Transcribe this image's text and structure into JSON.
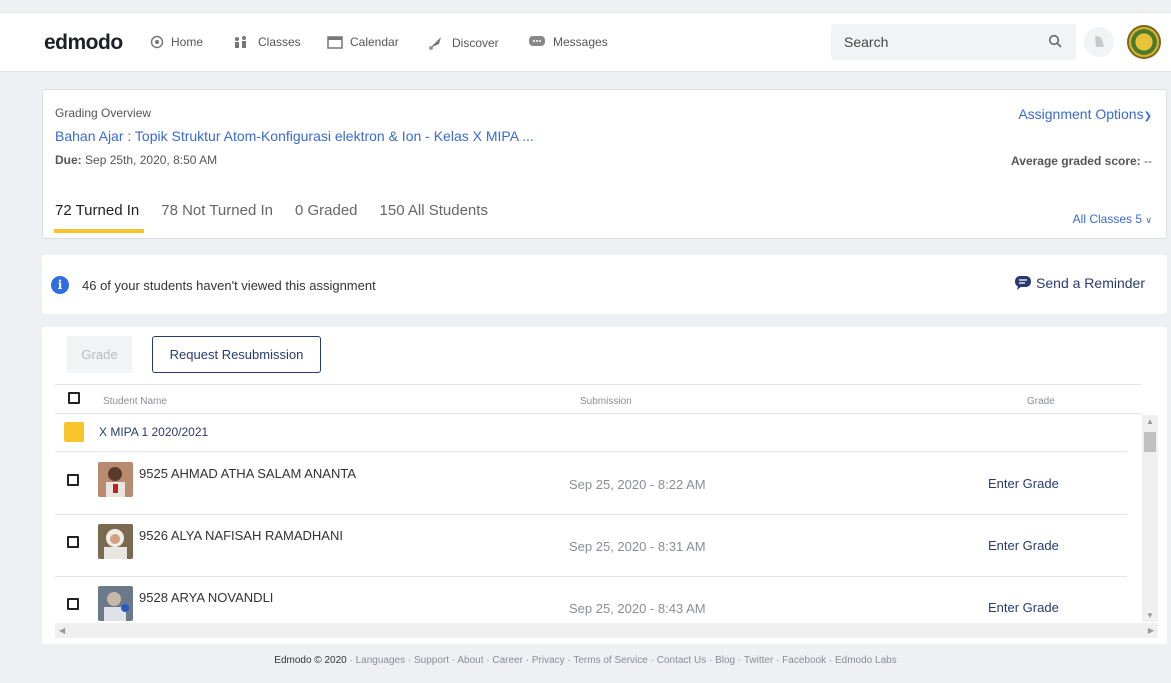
{
  "header": {
    "logo": "edmodo",
    "nav": [
      {
        "label": "Home",
        "icon": "home-icon"
      },
      {
        "label": "Classes",
        "icon": "classes-icon"
      },
      {
        "label": "Calendar",
        "icon": "calendar-icon"
      },
      {
        "label": "Discover",
        "icon": "discover-icon"
      },
      {
        "label": "Messages",
        "icon": "messages-icon"
      }
    ],
    "search_placeholder": "Search"
  },
  "overview": {
    "label": "Grading Overview",
    "title": "Bahan Ajar : Topik Struktur Atom-Konfigurasi elektron & Ion - Kelas X MIPA ...",
    "due_label": "Due:",
    "due_value": "Sep 25th, 2020, 8:50 AM",
    "options_label": "Assignment Options",
    "avg_label": "Average graded score:",
    "avg_value": "--",
    "tabs": [
      "72 Turned In",
      "78 Not Turned In",
      "0 Graded",
      "150 All Students"
    ],
    "all_classes_label": "All Classes",
    "all_classes_count": "5"
  },
  "info": {
    "message": "46 of your students haven't viewed this assignment",
    "reminder_label": "Send a Reminder"
  },
  "toolbar": {
    "grade_label": "Grade",
    "resubmit_label": "Request Resubmission"
  },
  "table": {
    "headers": {
      "name": "Student Name",
      "submission": "Submission",
      "grade": "Grade"
    },
    "group": "X MIPA 1 2020/2021",
    "rows": [
      {
        "name": "9525 AHMAD ATHA SALAM ANANTA",
        "submission": "Sep 25, 2020 - 8:22 AM",
        "grade": "Enter Grade"
      },
      {
        "name": "9526 ALYA NAFISAH RAMADHANI",
        "submission": "Sep 25, 2020 - 8:31 AM",
        "grade": "Enter Grade"
      },
      {
        "name": "9528 ARYA NOVANDLI",
        "submission": "Sep 25, 2020 - 8:43 AM",
        "grade": "Enter Grade"
      }
    ]
  },
  "footer": {
    "copyright": "Edmodo © 2020",
    "links": [
      "Languages",
      "Support",
      "About",
      "Career",
      "Privacy",
      "Terms of Service",
      "Contact Us",
      "Blog",
      "Twitter",
      "Facebook",
      "Edmodo Labs"
    ]
  }
}
